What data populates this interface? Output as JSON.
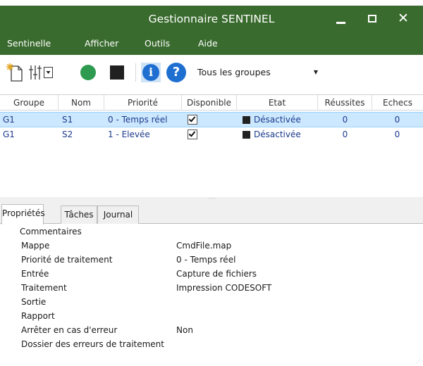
{
  "window": {
    "title": "Gestionnaire SENTINEL",
    "controls": {
      "minimize": "—",
      "maximize": "",
      "close": "✕"
    }
  },
  "menu": {
    "items": [
      "Sentinelle",
      "Afficher",
      "Outils",
      "Aide"
    ]
  },
  "toolbar": {
    "icons": [
      "new-document-icon",
      "settings-sliders-icon",
      "start-icon",
      "stop-icon",
      "info-icon",
      "help-icon"
    ],
    "info_glyph": "i",
    "help_glyph": "?",
    "group_filter": {
      "selected": "Tous les groupes",
      "arrow": "▼"
    }
  },
  "table": {
    "headers": [
      "Groupe",
      "Nom",
      "Priorité",
      "Disponible",
      "Etat",
      "Réussites",
      "Echecs"
    ],
    "rows": [
      {
        "groupe": "G1",
        "nom": "S1",
        "priorite": "0 - Temps réel",
        "disponible": true,
        "etat": "Désactivée",
        "reussites": "0",
        "echecs": "0",
        "selected": true
      },
      {
        "groupe": "G1",
        "nom": "S2",
        "priorite": "1 - Elevée",
        "disponible": true,
        "etat": "Désactivée",
        "reussites": "0",
        "echecs": "0",
        "selected": false
      }
    ]
  },
  "splitter": {
    "grip": "···"
  },
  "tabs": {
    "items": [
      "Propriétés",
      "Tâches",
      "Journal"
    ],
    "active": 0
  },
  "properties": [
    {
      "name": "Commentaires",
      "value": ""
    },
    {
      "name": "Mappe",
      "value": "CmdFile.map"
    },
    {
      "name": "Priorité de traitement",
      "value": "0 - Temps réel"
    },
    {
      "name": "Entrée",
      "value": "Capture de fichiers"
    },
    {
      "name": "Traitement",
      "value": "Impression CODESOFT"
    },
    {
      "name": "Sortie",
      "value": ""
    },
    {
      "name": "Rapport",
      "value": ""
    },
    {
      "name": "Arrêter en cas d'erreur",
      "value": "Non"
    },
    {
      "name": "Dossier des erreurs de traitement",
      "value": ""
    }
  ],
  "colors": {
    "titlebar": "#3a6b2e",
    "selection": "#cce8ff",
    "start": "#2f9b50",
    "info": "#1f6fd1",
    "cell_text": "#1b3a8c"
  }
}
